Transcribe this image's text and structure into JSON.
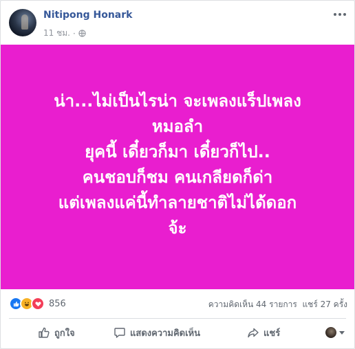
{
  "post": {
    "author": "Nitipong Honark",
    "time": "11 ชม.",
    "privacy_icon": "globe-icon",
    "background_color": "#e91ecf",
    "text_lines": [
      "น่า...ไม่เป็นไรน่า จะเพลงแร็ปเพลง",
      "หมอลำ",
      "ยุคนี้ เดี๋ยวก็มา เดี๋ยวก็ไป..",
      "คนชอบก็ชม คนเกลียดก็ด่า",
      "แต่เพลงแค่นี้ทำลายชาติไม่ได้ดอก",
      "จ้ะ"
    ]
  },
  "stats": {
    "reaction_icons": [
      "like-reaction-icon",
      "haha-reaction-icon",
      "love-reaction-icon"
    ],
    "reaction_count": "856",
    "comments": "ความคิดเห็น 44 รายการ",
    "shares": "แชร์ 27 ครั้ง"
  },
  "actions": {
    "like": "ถูกใจ",
    "comment": "แสดงความคิดเห็น",
    "share": "แชร์"
  },
  "colors": {
    "author_link": "#365899",
    "meta_text": "#90949c",
    "action_text": "#606770"
  }
}
